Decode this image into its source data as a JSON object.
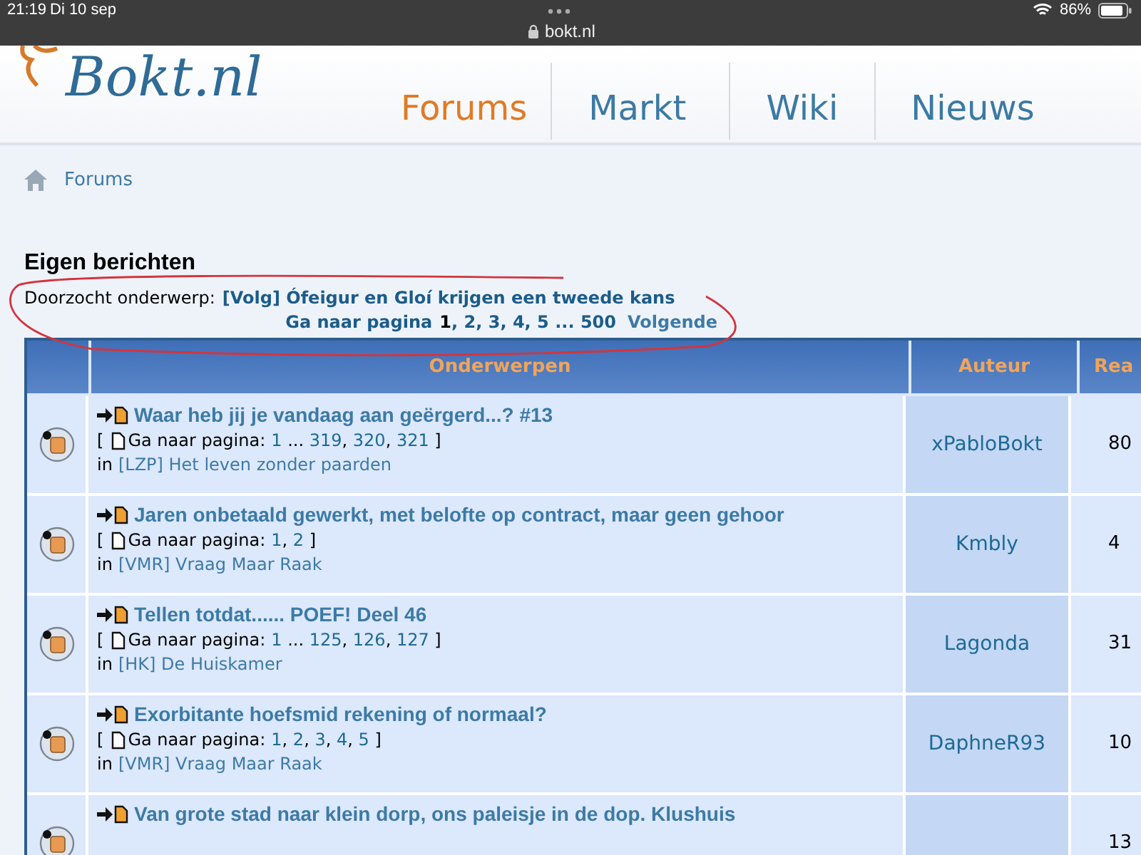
{
  "status_bar": {
    "time": "21:19",
    "date": "Di 10 sep",
    "url": "bokt.nl",
    "battery": "86%"
  },
  "site": {
    "logo": "Bokt.nl",
    "nav": [
      {
        "label": "Forums",
        "selected": true
      },
      {
        "label": "Markt",
        "selected": false
      },
      {
        "label": "Wiki",
        "selected": false
      },
      {
        "label": "Nieuws",
        "selected": false
      }
    ]
  },
  "breadcrumb": "Forums",
  "heading": "Eigen berichten",
  "searched": {
    "label": "Doorzocht onderwerp:",
    "topic": "[Volg] Ófeigur en Gloí krijgen een tweede kans"
  },
  "pagination": {
    "label": "Ga naar pagina",
    "parts": [
      {
        "text": "1",
        "kind": "current"
      },
      {
        "text": ", ",
        "kind": "sep"
      },
      {
        "text": "2",
        "kind": "link"
      },
      {
        "text": ", ",
        "kind": "sep"
      },
      {
        "text": "3",
        "kind": "link"
      },
      {
        "text": ", ",
        "kind": "sep"
      },
      {
        "text": "4",
        "kind": "link"
      },
      {
        "text": ", ",
        "kind": "sep"
      },
      {
        "text": "5",
        "kind": "link"
      },
      {
        "text": " ... ",
        "kind": "sep"
      },
      {
        "text": "500",
        "kind": "link"
      }
    ],
    "next": "Volgende"
  },
  "table": {
    "columns": [
      "Onderwerpen",
      "Auteur",
      "Rea"
    ],
    "rows": [
      {
        "title": "Waar heb jij je vandaag aan geërgerd...? #13",
        "open": "[",
        "pages_label": "Ga naar pagina:",
        "pages": [
          {
            "text": "1",
            "kind": "link"
          },
          {
            "text": " ... ",
            "kind": "sep"
          },
          {
            "text": "319",
            "kind": "link"
          },
          {
            "text": ", ",
            "kind": "sep"
          },
          {
            "text": "320",
            "kind": "link"
          },
          {
            "text": ", ",
            "kind": "sep"
          },
          {
            "text": "321",
            "kind": "link"
          },
          {
            "text": " ]",
            "kind": "sep"
          }
        ],
        "in": "in",
        "forum": "[LZP] Het leven zonder paarden",
        "author": "xPabloBokt",
        "count": "80"
      },
      {
        "title": "Jaren onbetaald gewerkt, met belofte op contract, maar geen gehoor",
        "open": "[",
        "pages_label": "Ga naar pagina:",
        "pages": [
          {
            "text": "1",
            "kind": "link"
          },
          {
            "text": ", ",
            "kind": "sep"
          },
          {
            "text": "2",
            "kind": "link"
          },
          {
            "text": " ]",
            "kind": "sep"
          }
        ],
        "in": "in",
        "forum": "[VMR] Vraag Maar Raak",
        "author": "Kmbly",
        "count": "4"
      },
      {
        "title": "Tellen totdat...... POEF! Deel 46",
        "open": "[",
        "pages_label": "Ga naar pagina:",
        "pages": [
          {
            "text": "1",
            "kind": "link"
          },
          {
            "text": " ... ",
            "kind": "sep"
          },
          {
            "text": "125",
            "kind": "link"
          },
          {
            "text": ", ",
            "kind": "sep"
          },
          {
            "text": "126",
            "kind": "link"
          },
          {
            "text": ", ",
            "kind": "sep"
          },
          {
            "text": "127",
            "kind": "link"
          },
          {
            "text": " ]",
            "kind": "sep"
          }
        ],
        "in": "in",
        "forum": "[HK] De Huiskamer",
        "author": "Lagonda",
        "count": "31"
      },
      {
        "title": "Exorbitante hoefsmid rekening of normaal?",
        "open": "[",
        "pages_label": "Ga naar pagina:",
        "pages": [
          {
            "text": "1",
            "kind": "link"
          },
          {
            "text": ", ",
            "kind": "sep"
          },
          {
            "text": "2",
            "kind": "link"
          },
          {
            "text": ", ",
            "kind": "sep"
          },
          {
            "text": "3",
            "kind": "link"
          },
          {
            "text": ", ",
            "kind": "sep"
          },
          {
            "text": "4",
            "kind": "link"
          },
          {
            "text": ", ",
            "kind": "sep"
          },
          {
            "text": "5",
            "kind": "link"
          },
          {
            "text": " ]",
            "kind": "sep"
          }
        ],
        "in": "in",
        "forum": "[VMR] Vraag Maar Raak",
        "author": "DaphneR93",
        "count": "10"
      },
      {
        "title": "Van grote stad naar klein dorp, ons paleisje in de dop. Klushuis",
        "count": "13"
      }
    ]
  }
}
